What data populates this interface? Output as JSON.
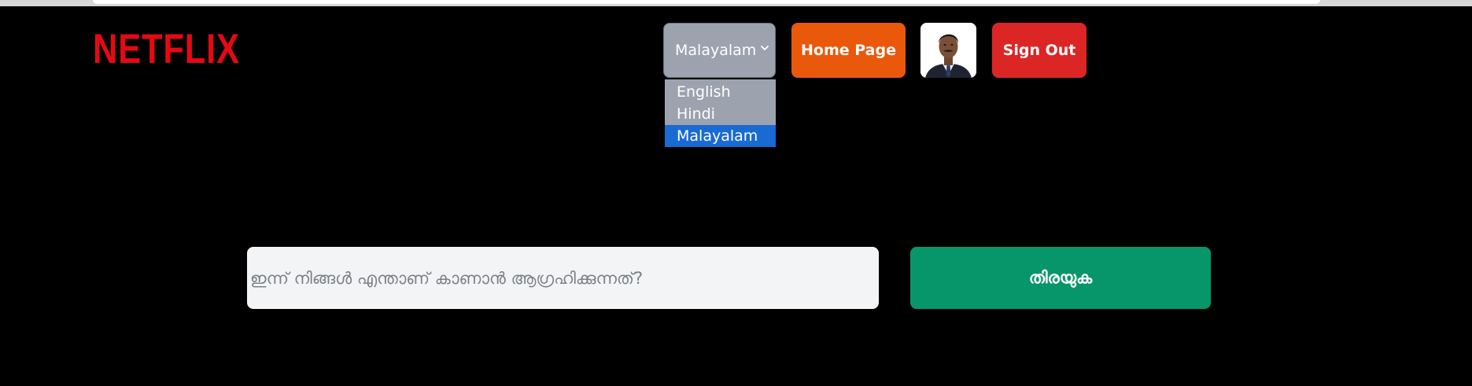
{
  "header": {
    "logo_text": "NETFLIX",
    "language_select": {
      "selected": "Malayalam",
      "options": [
        "English",
        "Hindi",
        "Malayalam"
      ],
      "highlighted_option": "Malayalam"
    },
    "home_button_label": "Home Page",
    "sign_out_label": "Sign Out",
    "avatar_icon": "user-photo-icon"
  },
  "search": {
    "placeholder": "ഇന്ന് നിങ്ങൾ എന്താണ് കാണാൻ ആഗ്രഹിക്കുന്നത്?",
    "button_label": "തിരയുക"
  },
  "colors": {
    "background": "#000000",
    "logo": "#e50914",
    "home_button": "#ea580c",
    "sign_out_button": "#dc2626",
    "search_button": "#07966a",
    "select_bg": "#9ca3af",
    "selected_option": "#1a6ad3"
  }
}
